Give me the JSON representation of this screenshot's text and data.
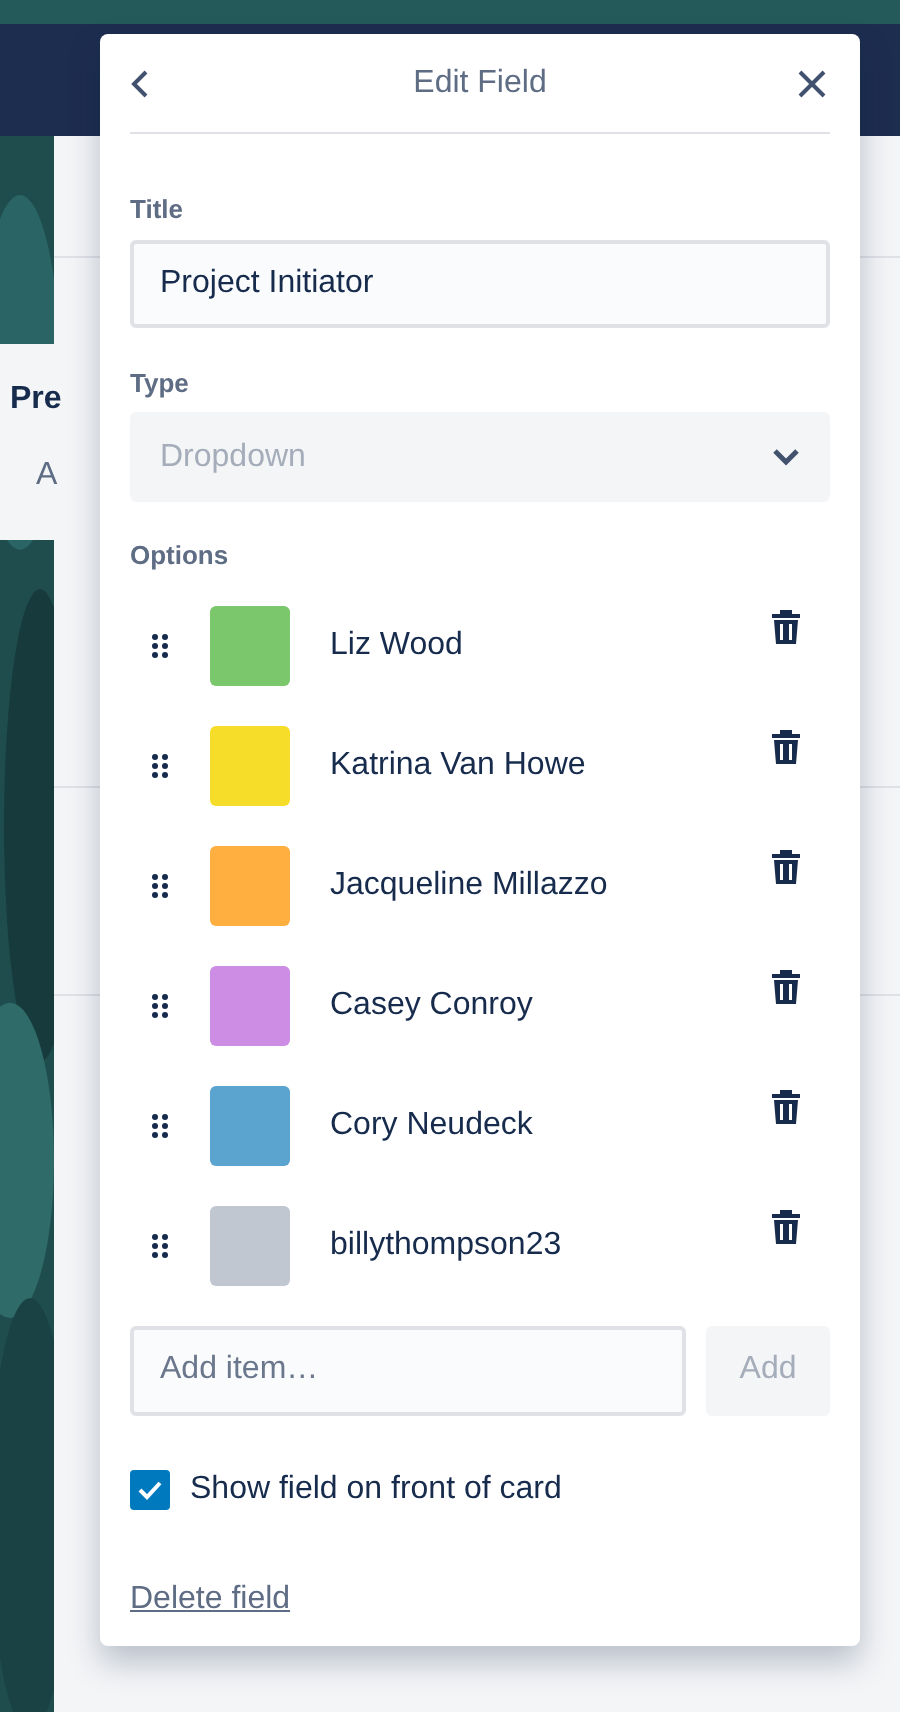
{
  "background": {
    "card_title": "Pre",
    "add_label": "A"
  },
  "dialog": {
    "title": "Edit Field",
    "title_field": {
      "label": "Title",
      "value": "Project Initiator"
    },
    "type_field": {
      "label": "Type",
      "value": "Dropdown",
      "disabled": true
    },
    "options_label": "Options",
    "options": [
      {
        "name": "Liz Wood",
        "color": "#7bc86c"
      },
      {
        "name": "Katrina Van Howe",
        "color": "#f5dd29"
      },
      {
        "name": "Jacqueline Millazzo",
        "color": "#ffaf3f"
      },
      {
        "name": "Casey Conroy",
        "color": "#cd8de5"
      },
      {
        "name": "Cory Neudeck",
        "color": "#5ba4cf"
      },
      {
        "name": "billythompson23",
        "color": "#c1c7d0"
      }
    ],
    "add_item": {
      "placeholder": "Add item…",
      "button": "Add",
      "disabled": true
    },
    "show_on_card": {
      "label": "Show field on front of card",
      "checked": true
    },
    "delete_link": "Delete field"
  }
}
